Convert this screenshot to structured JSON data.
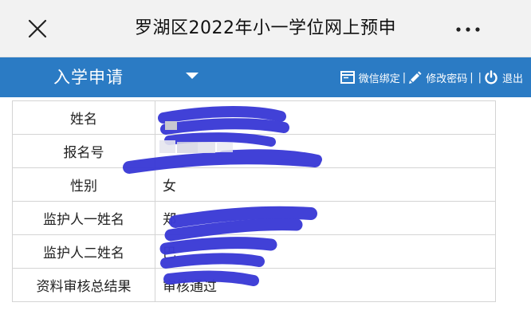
{
  "header": {
    "title": "罗湖区2022年小一学位网上预申"
  },
  "nav": {
    "apply_label": "入学申请",
    "wechat_label": "微信绑定",
    "password_label": "修改密码",
    "logout_label": "退出",
    "separator": "|"
  },
  "table": {
    "rows": [
      {
        "label": "姓名",
        "value": ""
      },
      {
        "label": "报名号",
        "value": ""
      },
      {
        "label": "性别",
        "value": "女"
      },
      {
        "label": "监护人一姓名",
        "value": "郑"
      },
      {
        "label": "监护人二姓名",
        "value": "巴"
      },
      {
        "label": "资料审核总结果",
        "value": "审核通过"
      }
    ]
  },
  "colors": {
    "nav_bg": "#2b7bc4",
    "status_red": "#e2231a",
    "redaction_ink": "#3b3bd6"
  }
}
